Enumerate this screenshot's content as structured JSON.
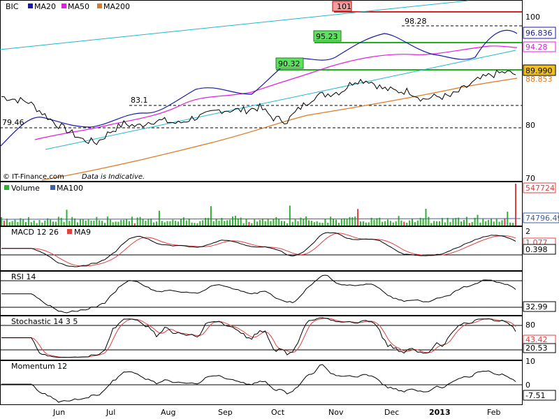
{
  "colors": {
    "price": "#000000",
    "ma20": "#1a1aa6",
    "ma50": "#e020e0",
    "ma200": "#e07820",
    "channel": "#20b8d0",
    "resist": "#e02020",
    "support": "#20b020",
    "volume": "#30b030",
    "volume_up": "#e04040",
    "ma100": "#4060a0",
    "macd": "#000000",
    "macd_signal": "#e04040"
  },
  "months": [
    "Jun",
    "Jul",
    "Aug",
    "Sep",
    "Oct",
    "Nov",
    "Dec",
    "2013",
    "Feb"
  ],
  "chart_data": [
    {
      "type": "line",
      "panel": "price",
      "legend": [
        "BIC",
        "MA20",
        "MA50",
        "MA200"
      ],
      "copyright": "© IT-Finance.com",
      "note": "Data is Indicative.",
      "yticks": [
        100,
        90,
        80,
        70
      ],
      "ylim": [
        67,
        103
      ],
      "n": 190,
      "series": [
        {
          "name": "BIC",
          "anchors": [
            [
              0,
              85
            ],
            [
              10,
              84
            ],
            [
              15,
              82
            ],
            [
              20,
              80
            ],
            [
              25,
              78.5
            ],
            [
              30,
              77
            ],
            [
              35,
              76.5
            ],
            [
              40,
              78.5
            ],
            [
              45,
              80
            ],
            [
              50,
              79.5
            ],
            [
              55,
              80.5
            ],
            [
              60,
              80.5
            ],
            [
              65,
              80
            ],
            [
              70,
              81
            ],
            [
              75,
              81.5
            ],
            [
              80,
              82.5
            ],
            [
              85,
              82.5
            ],
            [
              90,
              82.5
            ],
            [
              95,
              83
            ],
            [
              100,
              81
            ],
            [
              105,
              80.5
            ],
            [
              110,
              83
            ],
            [
              115,
              85
            ],
            [
              120,
              85.5
            ],
            [
              125,
              86
            ],
            [
              130,
              88
            ],
            [
              135,
              88
            ],
            [
              140,
              86.5
            ],
            [
              145,
              86
            ],
            [
              150,
              86
            ],
            [
              155,
              84.5
            ],
            [
              160,
              85
            ],
            [
              165,
              85
            ],
            [
              170,
              86.5
            ],
            [
              175,
              88
            ],
            [
              180,
              89
            ],
            [
              185,
              89.5
            ],
            [
              190,
              89
            ]
          ]
        },
        {
          "name": "MA20",
          "label": "96.836"
        },
        {
          "name": "MA50",
          "label": "94.28"
        },
        {
          "name": "MA200",
          "label": "88.853"
        }
      ],
      "price_label": "89.990",
      "annotations": [
        {
          "text": "101",
          "value": 101
        },
        {
          "text": "98.28",
          "value": 98.28
        },
        {
          "text": "95.23",
          "value": 95.23
        },
        {
          "text": "90.32",
          "value": 90.32
        },
        {
          "text": "83.1",
          "value": 83.1
        },
        {
          "text": "79.46",
          "value": 79.46
        }
      ]
    },
    {
      "type": "bar",
      "panel": "volume",
      "legend": [
        "Volume",
        "MA100"
      ],
      "labels": [
        "547724",
        "74796.49"
      ],
      "peak_value": 547724,
      "ma100": 74796.49
    },
    {
      "type": "line",
      "panel": "macd",
      "legend": [
        "MACD 12 26",
        "MA9"
      ],
      "labels": [
        "2",
        "1.077",
        "0.398"
      ]
    },
    {
      "type": "line",
      "panel": "rsi",
      "legend": [
        "RSI 14"
      ],
      "labels": [
        "32.99"
      ]
    },
    {
      "type": "line",
      "panel": "stochastic",
      "legend": [
        "Stochastic 14 3 5"
      ],
      "labels": [
        "80",
        "43.42",
        "20.53"
      ]
    },
    {
      "type": "line",
      "panel": "momentum",
      "legend": [
        "Momentum 12"
      ],
      "labels": [
        "10",
        "0",
        "-7.51"
      ]
    }
  ]
}
